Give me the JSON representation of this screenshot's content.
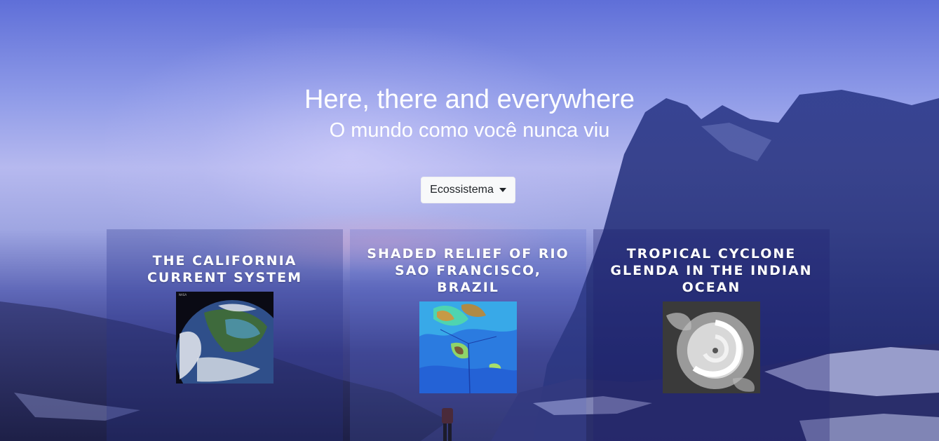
{
  "hero": {
    "title": "Here, there and everywhere",
    "subtitle": "O mundo como você nunca viu"
  },
  "dropdown": {
    "selected": "Ecossistema",
    "icon": "caret-down-icon"
  },
  "cards": [
    {
      "title": "THE CALIFORNIA CURRENT SYSTEM",
      "image": "satellite-earth-image"
    },
    {
      "title": "SHADED RELIEF OF RIO SAO FRANCISCO, BRAZIL",
      "image": "relief-map-image"
    },
    {
      "title": "TROPICAL CYCLONE GLENDA IN THE INDIAN OCEAN",
      "image": "cyclone-image"
    }
  ],
  "colors": {
    "accent_text": "#ffffff",
    "button_bg": "#f8f9fa"
  }
}
